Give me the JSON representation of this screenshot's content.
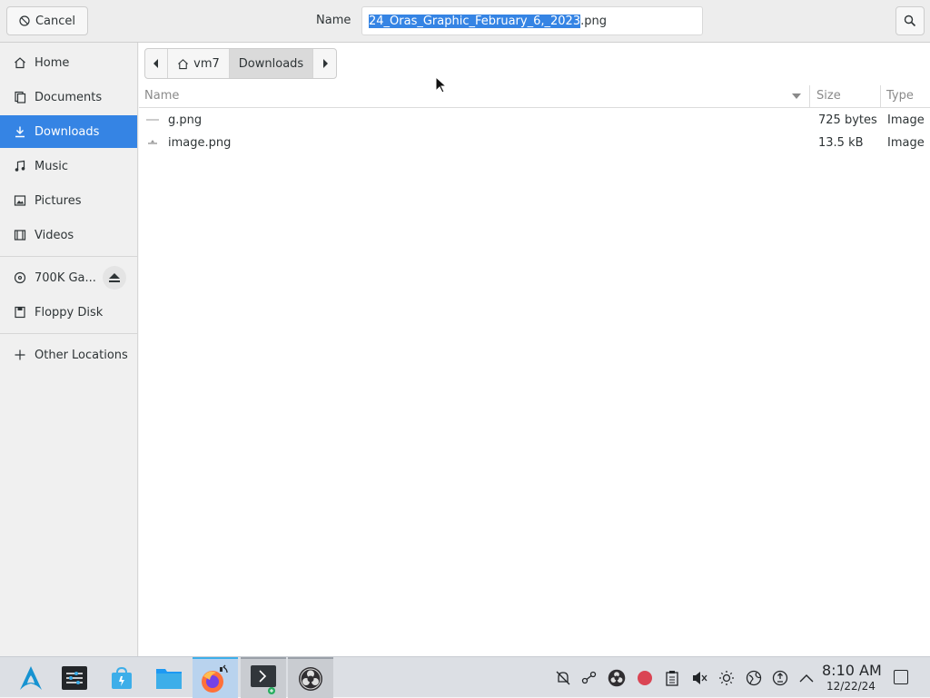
{
  "header": {
    "cancel_label": "Cancel",
    "name_label": "Name",
    "filename_selected": "24_Oras_Graphic_February_6,_2023",
    "filename_ext": ".png"
  },
  "sidebar": {
    "items": [
      {
        "label": "Home",
        "icon": "home-icon"
      },
      {
        "label": "Documents",
        "icon": "documents-icon"
      },
      {
        "label": "Downloads",
        "icon": "downloads-icon",
        "active": true
      },
      {
        "label": "Music",
        "icon": "music-icon"
      },
      {
        "label": "Pictures",
        "icon": "pictures-icon"
      },
      {
        "label": "Videos",
        "icon": "videos-icon"
      },
      {
        "label": "700K Ga...",
        "icon": "optical-disc-icon"
      },
      {
        "label": "Floppy Disk",
        "icon": "floppy-disk-icon"
      },
      {
        "label": "Other Locations",
        "icon": "plus-icon"
      }
    ]
  },
  "pathbar": {
    "home_label": "vm7",
    "current_label": "Downloads"
  },
  "columns": {
    "name": "Name",
    "size": "Size",
    "type": "Type"
  },
  "files": [
    {
      "name": "g.png",
      "size": "725 bytes",
      "type": "Image"
    },
    {
      "name": "image.png",
      "size": "13.5 kB",
      "type": "Image"
    }
  ],
  "taskbar": {
    "time": "8:10 AM",
    "date": "12/22/24"
  },
  "colors": {
    "accent": "#3584e4",
    "taskbar": "#dcdfe4",
    "record": "#da4453"
  }
}
